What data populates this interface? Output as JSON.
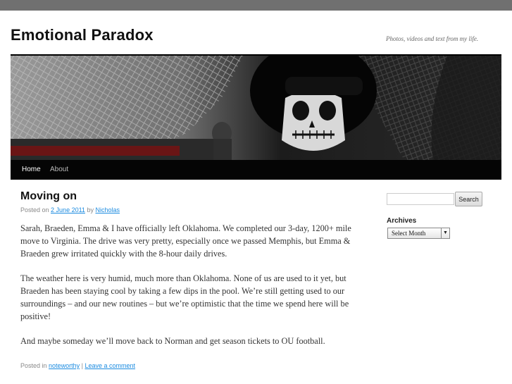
{
  "site": {
    "title": "Emotional Paradox",
    "description": "Photos, videos and text from my life."
  },
  "nav": {
    "items": [
      {
        "label": "Home"
      },
      {
        "label": "About"
      }
    ]
  },
  "post": {
    "title": "Moving on",
    "posted_on_prefix": "Posted on",
    "date": "2 June 2011",
    "by_text": "by",
    "author": "Nicholas",
    "paragraphs": [
      "Sarah, Braeden, Emma & I have officially left Oklahoma. We completed our 3-day, 1200+ mile move to Virginia. The drive was very pretty, especially once we passed Memphis, but Emma & Braeden grew irritated quickly with the 8-hour daily drives.",
      "The weather here is very humid, much more than Oklahoma. None of us are used to it yet, but Braeden has been staying cool by taking a few dips in the pool. We’re still getting used to our surroundings – and our new routines – but we’re optimistic that the time we spend here will be positive!",
      "And maybe someday we’ll move back to Norman and get season tickets to OU football."
    ],
    "posted_in_prefix": "Posted in",
    "category": "noteworthy",
    "separator": "|",
    "comment_link": "Leave a comment"
  },
  "sidebar": {
    "search": {
      "button_label": "Search",
      "value": "",
      "placeholder": ""
    },
    "archives": {
      "title": "Archives",
      "select_value": "Select Month"
    }
  },
  "icons": {
    "select_arrow": "dropdown-arrow-icon"
  },
  "colors": {
    "link": "#1b8be0",
    "nav_background": "#050505",
    "outer_background": "#666666"
  }
}
